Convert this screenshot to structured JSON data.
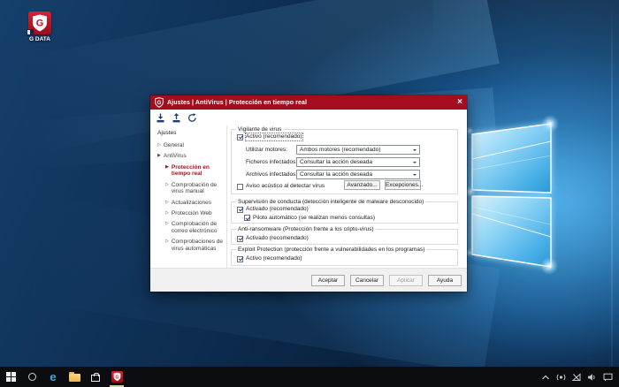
{
  "colors": {
    "titlebar_red": "#a30d1d",
    "gdata_red": "#c00d1e",
    "tree_selected_red": "#b00c1c",
    "taskbar_active_indicator": "#d5cfa0",
    "desktop_accent_blue": "#48ace8"
  },
  "desktop": {
    "gdata_icon_label": "G DATA"
  },
  "dialog": {
    "title": "Ajustes | AntiVirus | Protección en tiempo real",
    "close_glyph": "×",
    "tree": {
      "header": "Ajustes",
      "items": [
        {
          "label": "General",
          "arrow": "▷",
          "selected": false
        },
        {
          "label": "AntiVirus",
          "arrow": "▶",
          "selected": false
        },
        {
          "label": "Protección en tiempo real",
          "arrow": "▶",
          "selected": true
        },
        {
          "label": "Comprobación de virus manual",
          "arrow": "▷",
          "selected": false
        },
        {
          "label": "Actualizaciones",
          "arrow": "▷",
          "selected": false
        },
        {
          "label": "Protección Web",
          "arrow": "▷",
          "selected": false
        },
        {
          "label": "Comprobación de correo electrónico",
          "arrow": "▷",
          "selected": false
        },
        {
          "label": "Comprobaciones de virus automáticas",
          "arrow": "▷",
          "selected": false
        }
      ]
    },
    "vigilante": {
      "legend": "Vigilante de virus",
      "active_checkbox": {
        "label": "Activo (recomendado)",
        "checked": true
      },
      "rows": [
        {
          "label": "Utilizar motores:",
          "value": "Ambos motores (recomendado)"
        },
        {
          "label": "Ficheros infectados:",
          "value": "Consultar la acción deseada"
        },
        {
          "label": "Archivos infectados:",
          "value": "Consultar la acción deseada"
        }
      ],
      "aviso_checkbox": {
        "label": "Aviso acústico al detectar virus",
        "checked": false
      },
      "advanced_button": "Avanzado...",
      "exceptions_button": "Excepciones..."
    },
    "conducta": {
      "legend": "Supervisión de conducta (detección inteligente de malware desconocido)",
      "checkbox": {
        "label": "Activado (recomendado)",
        "checked": true
      },
      "sub_checkbox": {
        "label": "Piloto automático (se realizan menos consultas)",
        "checked": true
      }
    },
    "ransomware": {
      "legend": "Anti-ransomware (Protección frente a los cripto-virus)",
      "checkbox": {
        "label": "Activado (recomendado)",
        "checked": true
      }
    },
    "exploit": {
      "legend": "Exploit Protection (protección frente a vulnerabilidades en los programas)",
      "checkbox": {
        "label": "Activo (recomendado)",
        "checked": true
      }
    },
    "footer": {
      "accept": "Aceptar",
      "cancel": "Cancelar",
      "apply": "Aplicar",
      "apply_disabled": true,
      "help": "Ayuda"
    }
  }
}
